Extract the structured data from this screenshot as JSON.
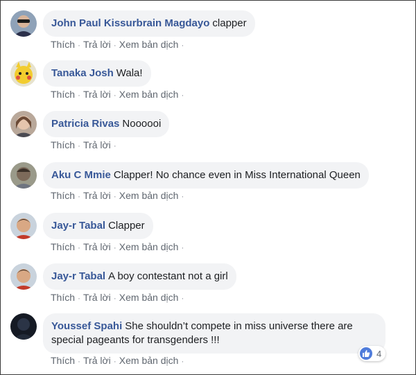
{
  "comments": [
    {
      "author": "John Paul Kissurbrain Magdayo",
      "text": "clapper",
      "actions": [
        "Thích",
        "Trả lời",
        "Xem bản dịch"
      ]
    },
    {
      "author": "Tanaka Josh",
      "text": "Wala!",
      "actions": [
        "Thích",
        "Trả lời",
        "Xem bản dịch"
      ]
    },
    {
      "author": "Patricia Rivas",
      "text": "Noooooi",
      "actions": [
        "Thích",
        "Trả lời"
      ]
    },
    {
      "author": "Aku C Mmie",
      "text": "Clapper! No chance even in Miss International Queen",
      "actions": [
        "Thích",
        "Trả lời",
        "Xem bản dịch"
      ]
    },
    {
      "author": "Jay-r Tabal",
      "text": "Clapper",
      "actions": [
        "Thích",
        "Trả lời",
        "Xem bản dịch"
      ]
    },
    {
      "author": "Jay-r Tabal",
      "text": "A boy contestant not a girl",
      "actions": [
        "Thích",
        "Trả lời",
        "Xem bản dịch"
      ]
    },
    {
      "author": "Youssef Spahi",
      "text": "She shouldn’t compete in miss universe there are special pageants for transgenders !!!",
      "actions": [
        "Thích",
        "Trả lời",
        "Xem bản dịch"
      ],
      "reaction": {
        "icon": "thumbs-up-icon",
        "count": "4"
      }
    }
  ],
  "separator": "·",
  "colors": {
    "author": "#385898",
    "bubble": "#f2f3f5",
    "action": "#606770",
    "like": "#4f7cdb"
  }
}
